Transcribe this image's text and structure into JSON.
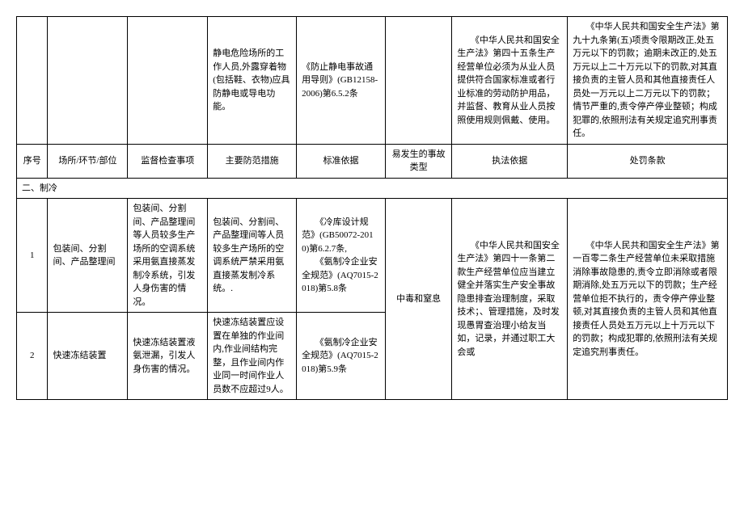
{
  "header": {
    "seq": "序号",
    "place": "场所/环节/部位",
    "inspect": "监督检查事项",
    "measure": "主要防范措施",
    "standard": "标准依据",
    "accident": "易发生的事故\n类型",
    "basis": "执法依据",
    "penalty": "处罚条款"
  },
  "row0": {
    "inspect": "静电危险场所的工作人员,外露穿着物(包括鞋、衣物)应具防静电或导电功能。",
    "measure": "《防止静电事故通用导则》(GB12158-2006)第6.5.2条",
    "basis": "　　《中华人民共和国安全生产法》第四十五条生产经营单位必须为从业人员提供符合国家标准或者行业标准的劳动防护用品，并监督、教育从业人员按照使用规则佩戴、使用。",
    "penalty": "　　《中华人民共和国安全生产法》第九十九条第(五)项责令限期改正,处五万元以下的罚款；逾期未改正的,处五万元以上二十万元以下的罚款,对其直接负责的主管人员和其他直接责任人员处一万元以上二万元以下的罚款；情节严重的,责令停产停业整顿；构成犯罪的,依照刑法有关规定追究刑事责任。"
  },
  "section": "二、制冷",
  "row1": {
    "seq": "1",
    "place": "包装间、分割间、产品整理间",
    "inspect": "包装间、分割间、产品整理间等人员较多生产场所的空调系统采用氨直接蒸发制冷系统，引发人身伤害的情况。",
    "measure": "包装间、分割间、产品整理间等人员较多生产场所的空调系统严禁采用氨直接蒸发制冷系统。.",
    "standard": "　　《冷库设计规范》(GB50072-2010)第6.2.7条,\n　　《氨制冷企业安全规范》(AQ7015-2018)第5.8条",
    "accident": "中毒和窒息",
    "basis": "　　《中华人民共和国安全生产法》第四十一条第二款生产经营单位应当建立健全并落实生产安全事故隐患排查治理制度，采取技术；、管理措施，及时发现愚胃查治理小给友当如，记录，并通过职工大会或",
    "penalty": "　　《中华人民共和国安全生产法》第一百零二条生产经营单位未采取措施消除事故隐患的,责令立即消除或者限期消除,处五万元以下的罚款；生产经营单位拒不执行的，责令停产停业整顿,对其直接负责的主管人员和其他直接责任人员处五万元以上十万元以下的罚款；构成犯罪的,依照刑法有关规定追究刑事责任。"
  },
  "row2": {
    "seq": "2",
    "place": "快速冻结装置",
    "inspect": "快速冻结装置液氨泄漏，引发人身伤害的情况。",
    "measure": "快速冻结装置应设置在单独的作业间内,作业间结构完整，且作业间内作业同一时间作业人员数不应超过9人。",
    "standard": "　　《氨制冷企业安全规范》(AQ7015-2018)第5.9条"
  }
}
